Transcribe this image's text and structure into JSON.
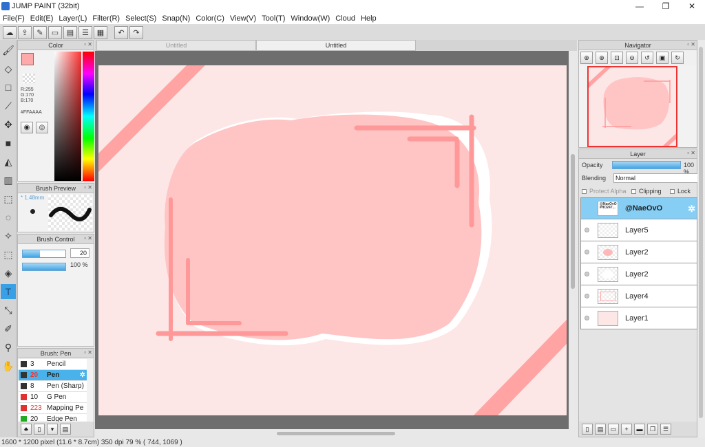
{
  "window": {
    "title": "JUMP PAINT (32bit)",
    "minimize": "—",
    "maximize": "❐",
    "close": "✕"
  },
  "menu": [
    "File(F)",
    "Edit(E)",
    "Layer(L)",
    "Filter(R)",
    "Select(S)",
    "Snap(N)",
    "Color(C)",
    "View(V)",
    "Tool(T)",
    "Window(W)",
    "Cloud",
    "Help"
  ],
  "tabs": {
    "inactive": "Untitled",
    "active": "Untitled"
  },
  "color_panel": {
    "title": "Color",
    "rgb": "R:255\nG:170\nB:170",
    "hex": "#FFAAAA",
    "main_color": "#ffaaaa"
  },
  "brush_preview": {
    "title": "Brush Preview",
    "size": "* 1.48mm"
  },
  "brush_control": {
    "title": "Brush Control",
    "size_value": "20",
    "size_fill": 0.4,
    "opacity_label": "100 %"
  },
  "brush_list": {
    "title": "Brush: Pen",
    "items": [
      {
        "size": "3",
        "name": "Pencil",
        "color": "#333333"
      },
      {
        "size": "20",
        "name": "Pen",
        "color": "#333333"
      },
      {
        "size": "8",
        "name": "Pen (Sharp)",
        "color": "#333333"
      },
      {
        "size": "10",
        "name": "G Pen",
        "color": "#e03030"
      },
      {
        "size": "223",
        "name": "Mapping Pe",
        "color": "#e03030"
      },
      {
        "size": "20",
        "name": "Edge Pen",
        "color": "#22aa22"
      }
    ]
  },
  "navigator": {
    "title": "Navigator"
  },
  "layer_panel": {
    "title": "Layer",
    "opacity_label": "Opacity",
    "opacity_value": "100 %",
    "blending_label": "Blending",
    "blending_value": "Normal",
    "protect_alpha": "Protect Alpha",
    "clipping": "Clipping",
    "lock": "Lock",
    "layers": [
      {
        "name": "@NaeOvO",
        "thumb_text": "@NaeOvO\n#HO247..."
      },
      {
        "name": "Layer5"
      },
      {
        "name": "Layer2"
      },
      {
        "name": "Layer2"
      },
      {
        "name": "Layer4"
      },
      {
        "name": "Layer1"
      }
    ]
  },
  "status": "1600 * 1200 pixel   (11.6 * 8.7cm)   350 dpi   79 %   ( 744, 1069 )",
  "accent": "#3aa0e6",
  "canvas_bg": "#fde6e6",
  "blob_color": "#ffc4c4",
  "stroke_color": "#ff9999"
}
